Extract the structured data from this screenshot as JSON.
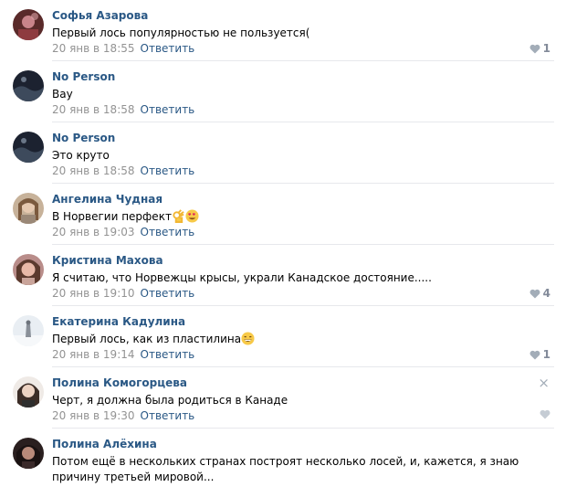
{
  "comments": [
    {
      "author": "Софья Азарова",
      "text": "Первый лось популярностью не пользуется(",
      "date": "20 янв в 18:55",
      "reply": "Ответить",
      "likes": "1",
      "avatar": "avatar-dark-red"
    },
    {
      "author": "No Person",
      "text": "Вау",
      "date": "20 янв в 18:58",
      "reply": "Ответить",
      "likes": "",
      "avatar": "avatar-dark-night"
    },
    {
      "author": "No Person",
      "text": "Это круто",
      "date": "20 янв в 18:58",
      "reply": "Ответить",
      "likes": "",
      "avatar": "avatar-dark-night"
    },
    {
      "author": "Ангелина Чудная",
      "text": "В Норвегии перфект",
      "emojis": [
        "ok-hand-emoji",
        "heart-eyes-emoji"
      ],
      "date": "20 янв в 19:03",
      "reply": "Ответить",
      "likes": "",
      "avatar": "avatar-portrait"
    },
    {
      "author": "Кристина Махова",
      "text": "Я считаю, что Норвежцы крысы, украли Канадское достояние.....",
      "date": "20 янв в 19:10",
      "reply": "Ответить",
      "likes": "4",
      "avatar": "avatar-portrait-pink"
    },
    {
      "author": "Екатерина Кадулина",
      "text": "Первый лось, как из пластилина",
      "emojis": [
        "grinning-emoji"
      ],
      "date": "20 янв в 19:14",
      "reply": "Ответить",
      "likes": "1",
      "avatar": "avatar-snow"
    },
    {
      "author": "Полина Комогорцева",
      "text": "Черт, я должна была родиться в Канаде",
      "date": "20 янв в 19:30",
      "reply": "Ответить",
      "likes": "",
      "close": "×",
      "avatar": "avatar-portrait-light"
    },
    {
      "author": "Полина Алёхина",
      "text": "Потом ещё в нескольких странах построят несколько лосей, и, кажется, я знаю причину третьей мировой...",
      "avatar": "avatar-portrait-dark"
    }
  ],
  "colors": {
    "author": "#2a5885",
    "date": "#939393",
    "reply": "#2a5885",
    "divider": "#e7e8ec",
    "like_icon": "#a3adb8"
  }
}
